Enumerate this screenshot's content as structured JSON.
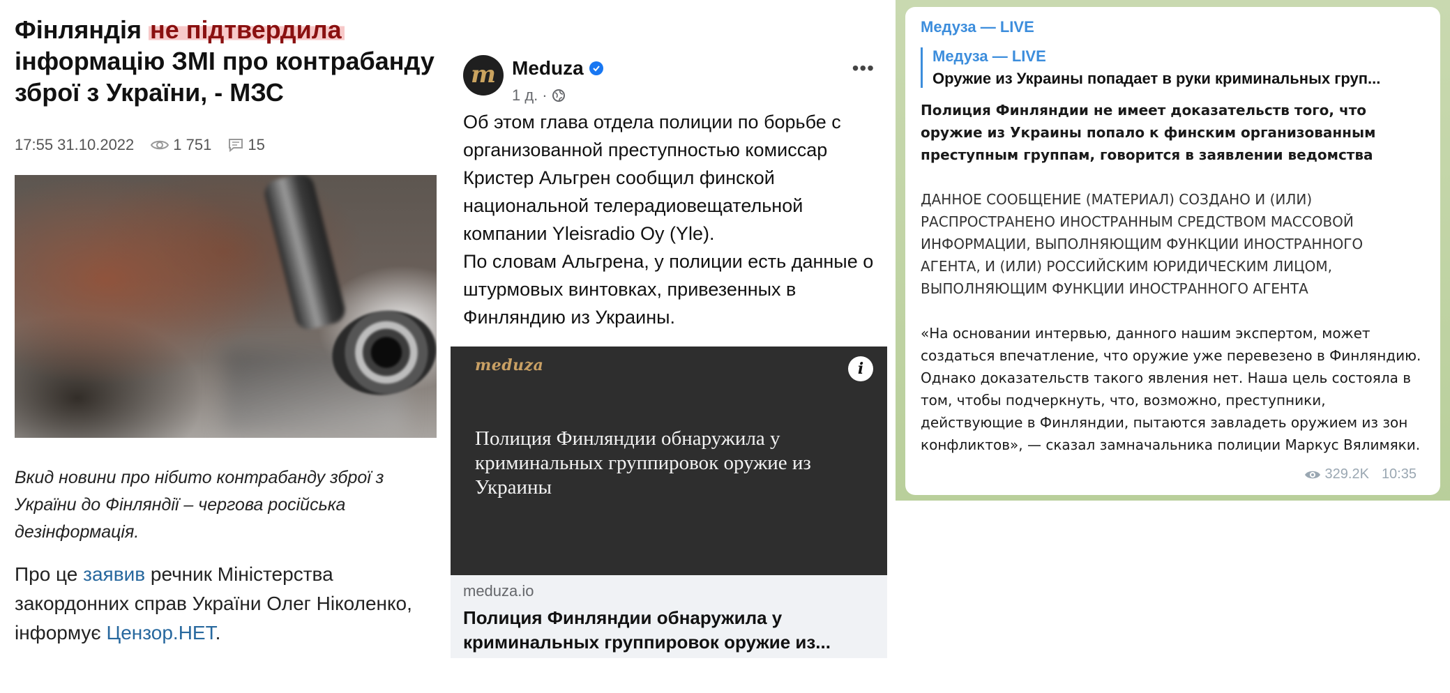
{
  "article": {
    "headline_before": "Фінляндія",
    "headline_highlight": "не підтвердила",
    "headline_after": "інформацію ЗМІ про контрабанду зброї з України, - МЗС",
    "datetime": "17:55 31.10.2022",
    "views": "1 751",
    "comments": "15",
    "caption": "Вкид новини про нібито контрабанду зброї з України до Фінляндії – чергова російська дезінформація.",
    "body_part1": "Про це",
    "body_link1": "заявив",
    "body_part2": "речник Міністерства закордонних справ України Олег Ніколенко, інформує",
    "body_link2": "Цензор.НЕТ",
    "body_end": "."
  },
  "facebook_post": {
    "page_name": "Meduza",
    "avatar_letter": "m",
    "time": "1 д.",
    "more": "•••",
    "text_paragraph1": "Об этом глава отдела полиции по борьбе с организованной преступностью комиссар Кристер Альгрен сообщил финской национальной телерадиовещательной компании Yleisradio Oy (Yle).",
    "text_paragraph2": "По словам Альгрена, у полиции есть данные о штурмовых винтовках, привезенных в Финляндию из Украины.",
    "card_logo": "meduza",
    "card_info": "i",
    "card_image_title": "Полиция Финляндии обнаружила у криминальных группировок оружие из Украины",
    "card_domain": "meduza.io",
    "card_title": "Полиция Финляндии обнаружила у криминальных группировок оружие из..."
  },
  "telegram_post": {
    "channel": "Медуза — LIVE",
    "reply_channel": "Медуза — LIVE",
    "reply_text": "Оружие из Украины попадает в руки криминальных груп...",
    "bold_paragraph": "Полиция Финляндии не имеет доказательств того, что оружие из Украины попало к финским организованным преступным группам, говорится в заявлении ведомства",
    "agent_notice": "ДАННОЕ СООБЩЕНИЕ (МАТЕРИАЛ) СОЗДАНО И (ИЛИ) РАСПРОСТРАНЕНО ИНОСТРАННЫМ СРЕДСТВОМ МАССОВОЙ ИНФОРМАЦИИ, ВЫПОЛНЯЮЩИМ ФУНКЦИИ ИНОСТРАННОГО АГЕНТА, И (ИЛИ) РОССИЙСКИМ ЮРИДИЧЕСКИМ ЛИЦОМ, ВЫПОЛНЯЮЩИМ ФУНКЦИИ ИНОСТРАННОГО АГЕНТА",
    "quote": "«На основании интервью, данного нашим экспертом, может создаться впечатление, что оружие уже перевезено в Финляндию. Однако доказательств такого явления нет. Наша цель состояла в том, чтобы подчеркнуть, что, возможно, преступники, действующие в Финляндии, пытаются завладеть оружием из зон конфликтов», — сказал замначальника полиции Маркус Вялимяки.",
    "views": "329.2K",
    "time": "10:35"
  },
  "colors": {
    "link": "#27689e",
    "highlight_bg": "#f7c9c9",
    "telegram_accent": "#3c8ddc",
    "facebook_verified": "#1877f2",
    "meduza_gold": "#c9a064"
  },
  "icons": [
    "eye-icon",
    "comment-icon",
    "verified-badge-icon",
    "globe-icon",
    "more-options-icon",
    "info-icon"
  ]
}
